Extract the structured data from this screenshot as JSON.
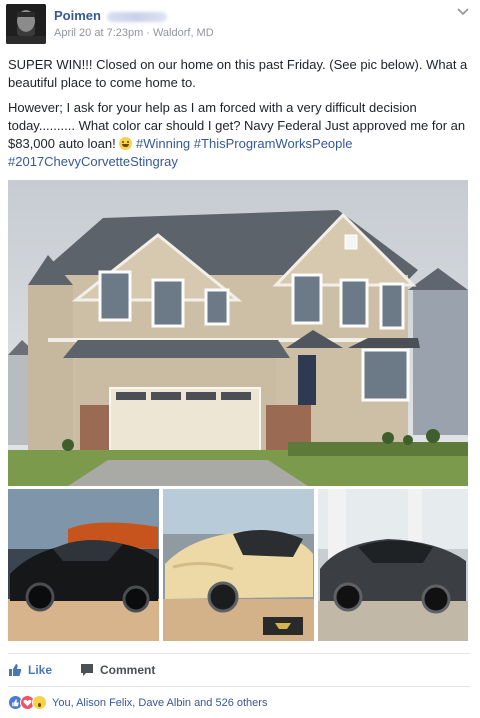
{
  "post": {
    "author": "Poimen",
    "date": "April 20 at 7:23pm",
    "separator": "·",
    "location": "Waldorf, MD",
    "paragraph1": "SUPER WIN!!! Closed on our home on this past Friday. (See pic below). What a beautiful place to come home to.",
    "paragraph2_text": "However; I ask for your help as I am forced with a very difficult decision today.......... What color car should I get? Navy Federal Just approved me for an $83,000 auto loan!",
    "hashtags": [
      "#Winning",
      "#ThisProgramWorksPeople",
      "#2017ChevyCorvetteStingray"
    ]
  },
  "actions": {
    "like_label": "Like",
    "comment_label": "Comment"
  },
  "reactions": {
    "summary": "You, Alison Felix, Dave Albin and 526 others",
    "types": [
      "like-icon",
      "love-icon",
      "wow-icon"
    ]
  },
  "colors": {
    "link": "#365899",
    "meta": "#90949c",
    "like_active": "#4b76b6"
  }
}
